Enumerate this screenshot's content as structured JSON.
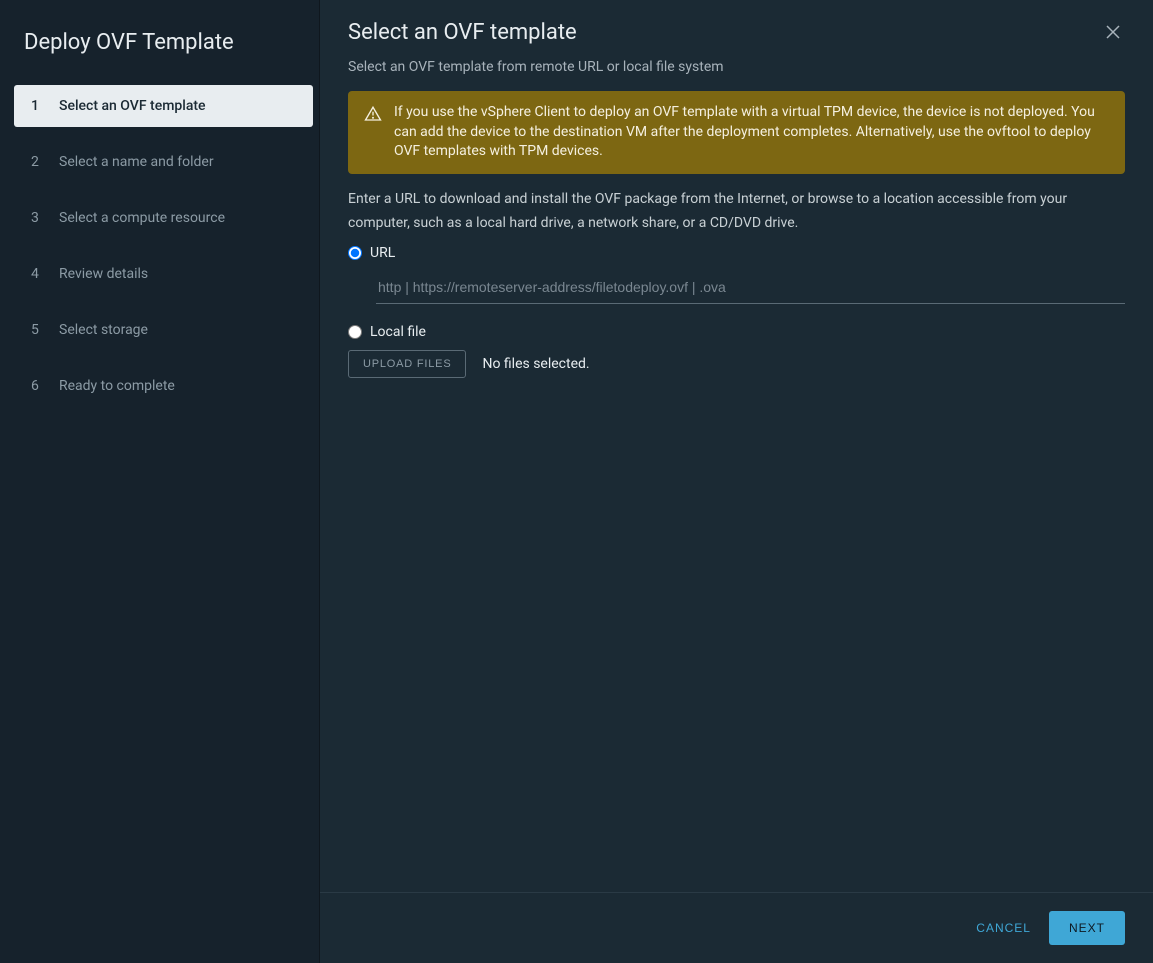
{
  "sidebar": {
    "title": "Deploy OVF Template",
    "steps": [
      {
        "num": "1",
        "label": "Select an OVF template",
        "state": "active"
      },
      {
        "num": "2",
        "label": "Select a name and folder",
        "state": "next"
      },
      {
        "num": "3",
        "label": "Select a compute resource",
        "state": "next"
      },
      {
        "num": "4",
        "label": "Review details",
        "state": "next"
      },
      {
        "num": "5",
        "label": "Select storage",
        "state": "next"
      },
      {
        "num": "6",
        "label": "Ready to complete",
        "state": "next"
      }
    ]
  },
  "main": {
    "title": "Select an OVF template",
    "subtitle": "Select an OVF template from remote URL or local file system",
    "alert": "If you use the vSphere Client to deploy an OVF template with a virtual TPM device, the device is not deployed. You can add the device to the destination VM after the deployment completes. Alternatively, use the ovftool to deploy OVF templates with TPM devices.",
    "instruction": "Enter a URL to download and install the OVF package from the Internet, or browse to a location accessible from your computer, such as a local hard drive, a network share, or a CD/DVD drive.",
    "source": {
      "url_label": "URL",
      "url_placeholder": "http | https://remoteserver-address/filetodeploy.ovf | .ova",
      "local_label": "Local file",
      "upload_button": "UPLOAD FILES",
      "upload_status": "No files selected."
    }
  },
  "footer": {
    "cancel": "CANCEL",
    "next": "NEXT"
  }
}
